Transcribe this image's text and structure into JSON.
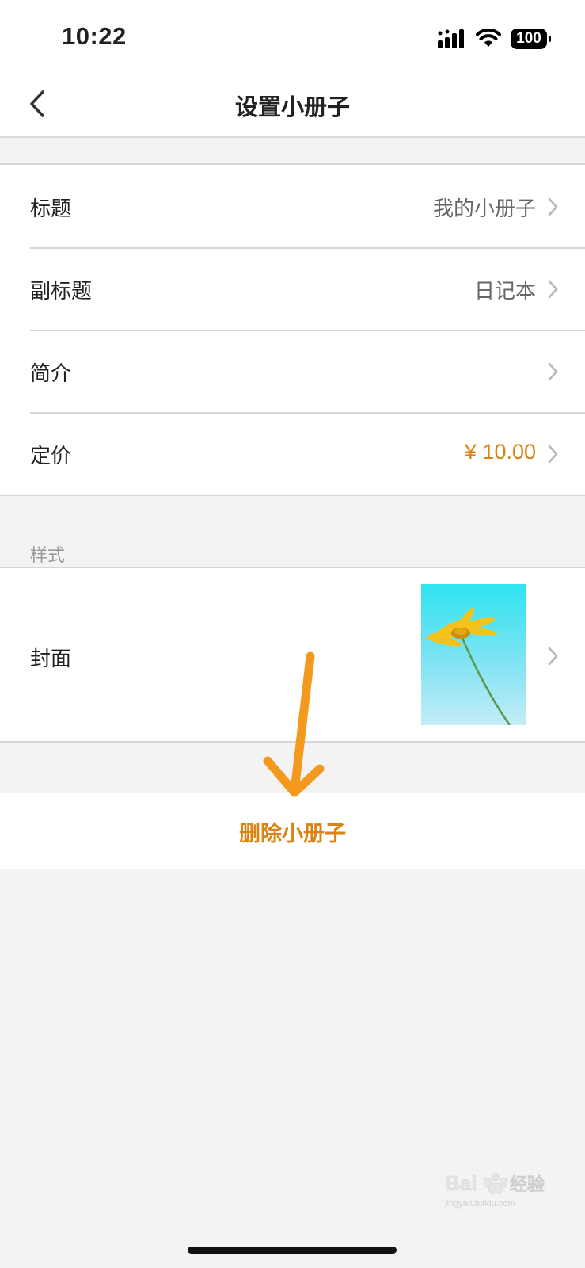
{
  "status_bar": {
    "time": "10:22",
    "battery": "100",
    "signal_icon": "cellular-signal-icon",
    "wifi_icon": "wifi-icon"
  },
  "nav": {
    "title": "设置小册子",
    "back_icon": "chevron-left-icon"
  },
  "settings": {
    "rows": [
      {
        "label": "标题",
        "value": "我的小册子"
      },
      {
        "label": "副标题",
        "value": "日记本"
      },
      {
        "label": "简介",
        "value": ""
      },
      {
        "label": "定价",
        "value": "¥ 10.00"
      }
    ]
  },
  "style_section": {
    "header": "样式",
    "cover_label": "封面",
    "cover_image": "yellow-daisy-on-cyan-sky"
  },
  "actions": {
    "delete_label": "删除小册子"
  },
  "colors": {
    "accent": "#d98414",
    "background": "#f3f3f3",
    "annotation_arrow": "#f39a1e"
  },
  "watermark": {
    "text": "Baidu经验",
    "subtext": "jingyan.baidu.com"
  }
}
